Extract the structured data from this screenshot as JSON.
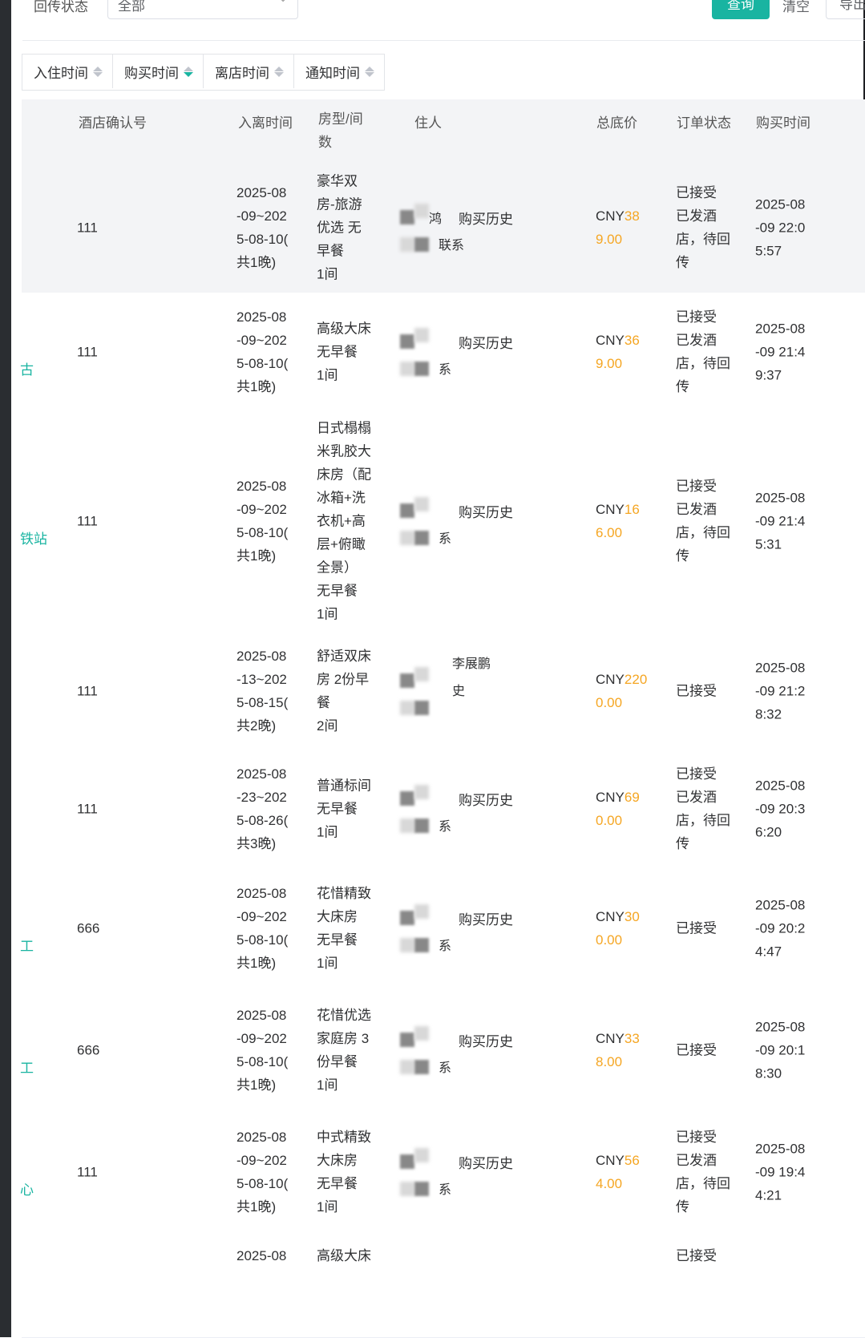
{
  "filter": {
    "status_label": "回传状态",
    "status_value": "全部",
    "query_button": "查询",
    "clear_button": "清空",
    "export_button": "导出"
  },
  "sort_buttons": [
    {
      "label": "入住时间",
      "active": false
    },
    {
      "label": "购买时间",
      "active": true
    },
    {
      "label": "离店时间",
      "active": false
    },
    {
      "label": "通知时间",
      "active": false
    }
  ],
  "table": {
    "headers": [
      "酒店确认号",
      "入离时间",
      "房型/间数",
      "住人",
      "总底价",
      "订单状态",
      "购买时间"
    ],
    "history_link": "购买历史",
    "rows": [
      {
        "left_text": "",
        "confirm_no": "111",
        "dates": [
          "2025-08",
          "-09~202",
          "5-08-10(",
          "共1晚)"
        ],
        "room": [
          "豪华双",
          "房-旅游",
          "优选 无",
          "早餐",
          "1间"
        ],
        "guest_frags": [
          "鸿",
          "联系"
        ],
        "price_cny": "CNY",
        "price_num": [
          "38",
          "9.00"
        ],
        "status": [
          "已接受",
          "已发酒",
          "店，待回",
          "传"
        ],
        "buy_time": [
          "2025-08",
          "-09 22:0",
          "5:57"
        ]
      },
      {
        "left_text": "古",
        "confirm_no": "111",
        "dates": [
          "2025-08",
          "-09~202",
          "5-08-10(",
          "共1晚)"
        ],
        "room": [
          "高级大床",
          "无早餐",
          "1间"
        ],
        "guest_frags": [
          "系"
        ],
        "price_cny": "CNY",
        "price_num": [
          "36",
          "9.00"
        ],
        "status": [
          "已接受",
          "已发酒",
          "店，待回",
          "传"
        ],
        "buy_time": [
          "2025-08",
          "-09 21:4",
          "9:37"
        ]
      },
      {
        "left_text": "铁站",
        "confirm_no": "111",
        "dates": [
          "2025-08",
          "-09~202",
          "5-08-10(",
          "共1晚)"
        ],
        "room": [
          "日式榻榻",
          "米乳胶大",
          "床房（配",
          "冰箱+洗",
          "衣机+高",
          "层+俯瞰",
          "全景）",
          "无早餐",
          "1间"
        ],
        "guest_frags": [
          "系"
        ],
        "price_cny": "CNY",
        "price_num": [
          "16",
          "6.00"
        ],
        "status": [
          "已接受",
          "已发酒",
          "店，待回",
          "传"
        ],
        "buy_time": [
          "2025-08",
          "-09 21:4",
          "5:31"
        ]
      },
      {
        "left_text": "",
        "confirm_no": "111",
        "dates": [
          "2025-08",
          "-13~202",
          "5-08-15(",
          "共2晚)"
        ],
        "room": [
          "舒适双床",
          "房 2份早",
          "餐",
          "2间"
        ],
        "guest_frags": [
          "李展鹏",
          "史"
        ],
        "price_cny": "CNY",
        "price_num": [
          "220",
          "0.00"
        ],
        "status": [
          "已接受"
        ],
        "buy_time": [
          "2025-08",
          "-09 21:2",
          "8:32"
        ]
      },
      {
        "left_text": "",
        "confirm_no": "111",
        "dates": [
          "2025-08",
          "-23~202",
          "5-08-26(",
          "共3晚)"
        ],
        "room": [
          "普通标间",
          "无早餐",
          "1间"
        ],
        "guest_frags": [
          "系"
        ],
        "price_cny": "CNY",
        "price_num": [
          "69",
          "0.00"
        ],
        "status": [
          "已接受",
          "已发酒",
          "店，待回",
          "传"
        ],
        "buy_time": [
          "2025-08",
          "-09 20:3",
          "6:20"
        ]
      },
      {
        "left_text": "工",
        "confirm_no": "666",
        "dates": [
          "2025-08",
          "-09~202",
          "5-08-10(",
          "共1晚)"
        ],
        "room": [
          "花惜精致",
          "大床房",
          "无早餐",
          "1间"
        ],
        "guest_frags": [
          "系"
        ],
        "price_cny": "CNY",
        "price_num": [
          "30",
          "0.00"
        ],
        "status": [
          "已接受"
        ],
        "buy_time": [
          "2025-08",
          "-09 20:2",
          "4:47"
        ]
      },
      {
        "left_text": "工",
        "confirm_no": "666",
        "dates": [
          "2025-08",
          "-09~202",
          "5-08-10(",
          "共1晚)"
        ],
        "room": [
          "花惜优选",
          "家庭房 3",
          "份早餐",
          "1间"
        ],
        "guest_frags": [
          "系"
        ],
        "price_cny": "CNY",
        "price_num": [
          "33",
          "8.00"
        ],
        "status": [
          "已接受"
        ],
        "buy_time": [
          "2025-08",
          "-09 20:1",
          "8:30"
        ]
      },
      {
        "left_text": "心",
        "confirm_no": "111",
        "dates": [
          "2025-08",
          "-09~202",
          "5-08-10(",
          "共1晚)"
        ],
        "room": [
          "中式精致",
          "大床房",
          "无早餐",
          "1间"
        ],
        "guest_frags": [
          "系"
        ],
        "price_cny": "CNY",
        "price_num": [
          "56",
          "4.00"
        ],
        "status": [
          "已接受",
          "已发酒",
          "店，待回",
          "传"
        ],
        "buy_time": [
          "2025-08",
          "-09 19:4",
          "4:21"
        ]
      },
      {
        "left_text": "",
        "confirm_no": "",
        "dates": [
          "2025-08"
        ],
        "room": [
          "高级大床"
        ],
        "guest_frags": [],
        "price_cny": "",
        "price_num": [],
        "status": [
          "已接受"
        ],
        "buy_time": []
      }
    ]
  }
}
